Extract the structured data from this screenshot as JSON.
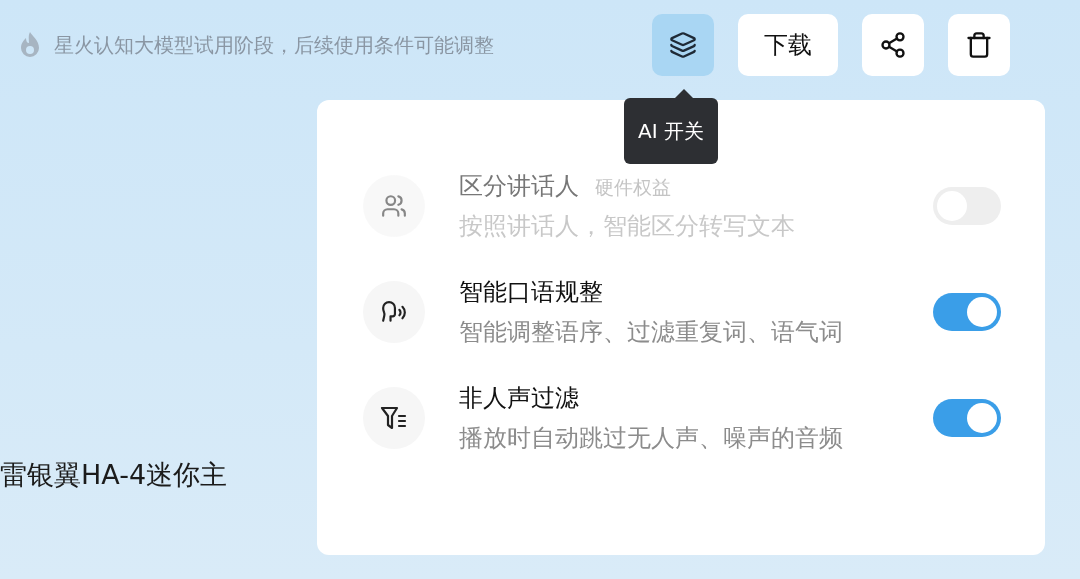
{
  "notice": {
    "text": "星火认知大模型试用阶段，后续使用条件可能调整"
  },
  "toolbar": {
    "ai_toggle": {
      "selected": true
    },
    "download": {
      "label": "下载"
    }
  },
  "tooltip": {
    "text": "AI 开关"
  },
  "recording_title": "雷银翼HA-4迷你主",
  "settings": [
    {
      "kind": "speaker",
      "title": "区分讲话人",
      "tag": "硬件权益",
      "description": "按照讲话人，智能区分转写文本",
      "disabled": true,
      "on": false
    },
    {
      "kind": "speech",
      "title": "智能口语规整",
      "description": "智能调整语序、过滤重复词、语气词",
      "disabled": false,
      "on": true
    },
    {
      "kind": "filter",
      "title": "非人声过滤",
      "description": "播放时自动跳过无人声、噪声的音频",
      "disabled": false,
      "on": true
    }
  ]
}
